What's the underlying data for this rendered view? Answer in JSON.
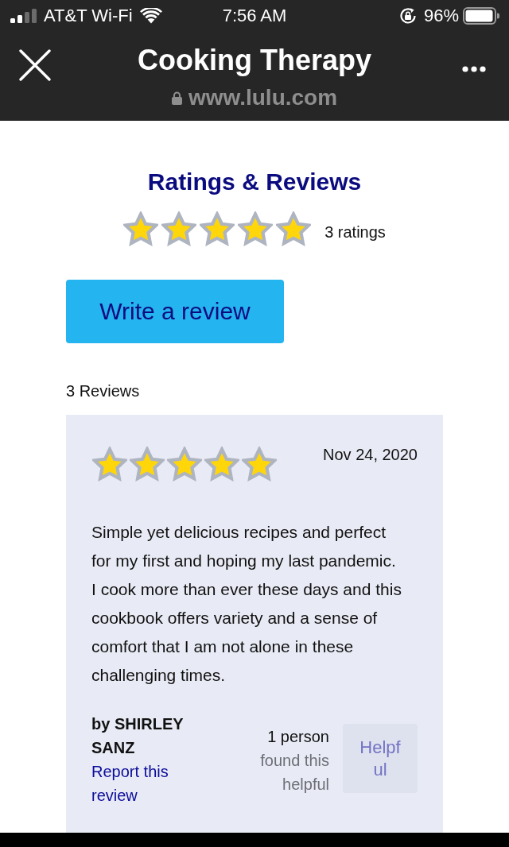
{
  "status_bar": {
    "carrier": "AT&T Wi-Fi",
    "time": "7:56 AM",
    "battery": "96%"
  },
  "header": {
    "title": "Cooking Therapy",
    "url": "www.lulu.com"
  },
  "ratings": {
    "heading": "Ratings & Reviews",
    "stars": 5,
    "count": "3 ratings"
  },
  "write_review_button": "Write a review",
  "reviews_count": "3 Reviews",
  "reviews": [
    {
      "stars": 5,
      "date": "Nov 24, 2020",
      "text": "Simple yet delicious recipes and perfect for my first and hoping my last pandemic. I cook more than ever these days and this cookbook offers variety and a sense of comfort that I am not alone in these challenging times.",
      "author": "by SHIRLEY SANZ",
      "report_link": "Report this review",
      "helpful_count": "1 person",
      "helpful_text": "found this helpful",
      "helpful_button": "Helpful"
    }
  ]
}
